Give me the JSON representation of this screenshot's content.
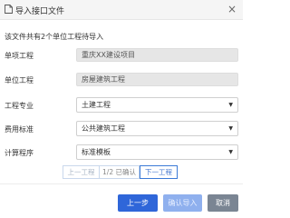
{
  "dialog": {
    "title": "导入接口文件",
    "close_symbol": "×",
    "title_icon": "file-import-icon"
  },
  "notice": "该文件共有2个单位工程待导入",
  "fields": {
    "project": {
      "label": "单项工程",
      "value": "重庆XX建设项目"
    },
    "unit": {
      "label": "单位工程",
      "value": "房屋建筑工程"
    },
    "specialty": {
      "label": "工程专业",
      "value": "土建工程"
    },
    "fee_standard": {
      "label": "费用标准",
      "value": "公共建筑工程"
    },
    "calc_program": {
      "label": "计算程序",
      "value": "标准模板"
    }
  },
  "pager": {
    "prev": "上一工程",
    "info": "1/2 已确认",
    "next": "下一工程"
  },
  "buttons": {
    "prev_step": "上一步",
    "confirm_import": "确认导入",
    "cancel": "取消"
  },
  "colors": {
    "primary": "#2f66d9",
    "primary_disabled": "#8fb0ee",
    "cancel": "#7a8593",
    "readonly_bg": "#e6e6e6"
  }
}
